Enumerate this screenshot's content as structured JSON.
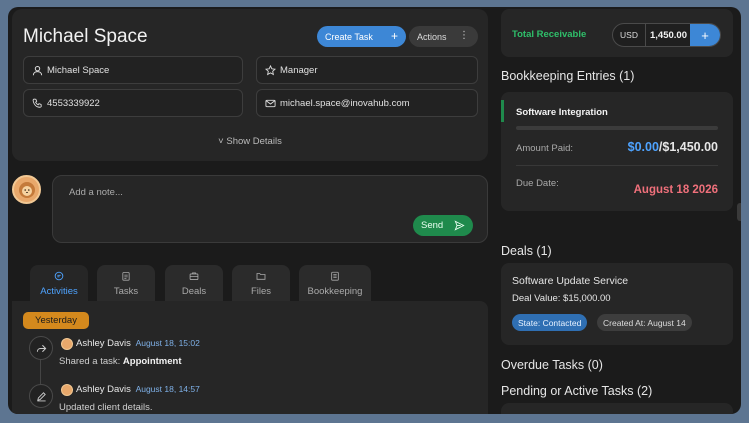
{
  "client": {
    "name": "Michael Space",
    "create_task_label": "Create Task",
    "actions_label": "Actions",
    "fields": {
      "contact_name": "Michael Space",
      "role": "Manager",
      "phone": "4553339922",
      "email": "michael.space@inovahub.com"
    },
    "show_details_label": "Show Details"
  },
  "note": {
    "placeholder": "Add a note...",
    "send_label": "Send"
  },
  "tabs": [
    {
      "label": "Activities",
      "icon": "chat-icon",
      "active": true
    },
    {
      "label": "Tasks",
      "icon": "clipboard-icon",
      "active": false
    },
    {
      "label": "Deals",
      "icon": "briefcase-icon",
      "active": false
    },
    {
      "label": "Files",
      "icon": "folder-icon",
      "active": false
    },
    {
      "label": "Bookkeeping",
      "icon": "ledger-icon",
      "active": false
    }
  ],
  "activity": {
    "day_label": "Yesterday",
    "items": [
      {
        "user": "Ashley Davis",
        "time": "August 18, 15:02",
        "prefix": "Shared a task: ",
        "detail": "Appointment",
        "icon": "share-icon"
      },
      {
        "user": "Ashley Davis",
        "time": "August 18, 14:57",
        "prefix": "Updated client details.",
        "detail": "",
        "icon": "edit-icon"
      }
    ]
  },
  "receivable": {
    "label": "Total Receivable",
    "currency": "USD",
    "amount": "1,450.00"
  },
  "bookkeeping": {
    "title": "Bookkeeping Entries (1)",
    "entry": {
      "name": "Software Integration",
      "paid_progress": 0.0,
      "amount_paid_label": "Amount Paid:",
      "paid": "$0.00",
      "total": "/$1,450.00",
      "due_label": "Due Date:",
      "due": "August 18 2026"
    }
  },
  "deals": {
    "title": "Deals (1)",
    "item": {
      "name": "Software Update Service",
      "value_label": "Deal Value: $15,000.00",
      "state": "State: Contacted",
      "created": "Created At: August 14"
    }
  },
  "overdue_title": "Overdue Tasks (0)",
  "pending_title": "Pending or Active Tasks (2)",
  "colors": {
    "accent_blue": "#3d87d6",
    "success_green": "#1f8a4c",
    "due_red": "#f0707b",
    "badge_orange": "#d4891d"
  }
}
